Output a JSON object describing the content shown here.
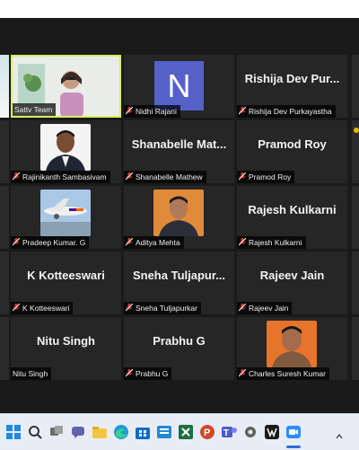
{
  "participants": [
    {
      "name": "Sattv Team",
      "muted": false,
      "video": true
    },
    {
      "name": "Nidhi Rajani",
      "muted": true,
      "avatar_letter": "N"
    },
    {
      "name": "Rishija Dev Purkayastha",
      "display": "Rishija  Dev  Pur...",
      "muted": true
    },
    {
      "name": "Rajinikanth Sambasivam",
      "muted": true,
      "photo": true
    },
    {
      "name": "Shanabelle Mathew",
      "display": "Shanabelle  Mat...",
      "muted": true
    },
    {
      "name": "Pramod Roy",
      "display": "Pramod Roy",
      "muted": true
    },
    {
      "name": "Pradeep Kumar. G",
      "muted": true,
      "photo": true
    },
    {
      "name": "Aditya Mehta",
      "muted": true,
      "photo": true
    },
    {
      "name": "Rajesh Kulkarni",
      "display": "Rajesh Kulkarni",
      "muted": true
    },
    {
      "name": "K Kotteeswari",
      "display": "K Kotteeswari",
      "muted": true
    },
    {
      "name": "Sneha Tuljapurkar",
      "display": "Sneha  Tuljapur...",
      "muted": true
    },
    {
      "name": "Rajeev Jain",
      "display": "Rajeev Jain",
      "muted": true
    },
    {
      "name": "Nitu Singh",
      "display": "Nitu Singh",
      "muted": false
    },
    {
      "name": "Prabhu G",
      "display": "Prabhu G",
      "muted": true
    },
    {
      "name": "Charles Suresh Kumar",
      "muted": true,
      "photo": true
    }
  ],
  "colors": {
    "active_speaker_border": "#d9ef5e",
    "mute_icon": "#e53935",
    "avatar_bg": "#5561c9"
  },
  "taskbar": {
    "icons": [
      "start-icon",
      "search-icon",
      "task-view-icon",
      "chat-icon",
      "file-explorer-icon",
      "edge-icon",
      "store-icon",
      "excel-icon",
      "powerpoint-icon",
      "teams-icon",
      "settings-icon",
      "app-icon",
      "zoom-icon"
    ]
  }
}
